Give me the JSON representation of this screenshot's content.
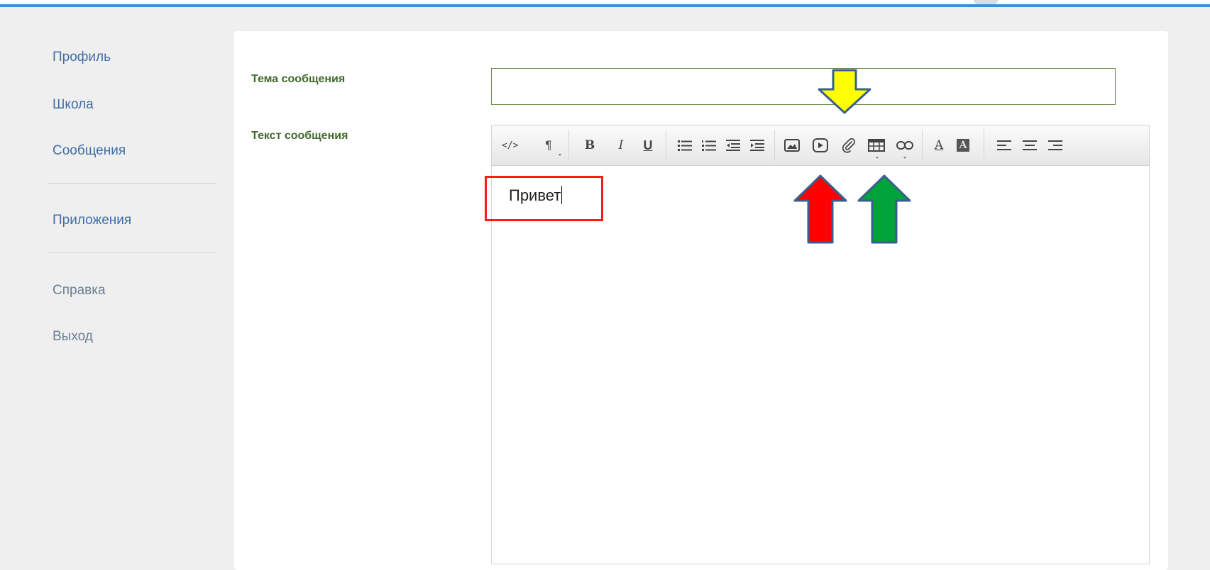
{
  "sidebar": {
    "items": [
      {
        "label": "Профиль"
      },
      {
        "label": "Школа"
      },
      {
        "label": "Сообщения"
      },
      {
        "label": "Приложения"
      },
      {
        "label": "Справка"
      },
      {
        "label": "Выход"
      }
    ]
  },
  "form": {
    "subject_label": "Тема сообщения",
    "subject_value": "",
    "body_label": "Текст сообщения",
    "body_text": "Привет"
  },
  "toolbar": {
    "buttons": [
      "html-source",
      "paragraph",
      "bold",
      "italic",
      "underline",
      "unordered-list",
      "ordered-list",
      "outdent",
      "indent",
      "image",
      "video",
      "file",
      "table",
      "link",
      "font-color",
      "background-color",
      "align-left",
      "align-center",
      "align-right"
    ],
    "glyphs": {
      "html": "</>",
      "paragraph": "¶",
      "bold": "B",
      "italic": "I",
      "underline": "U",
      "font_color": "A",
      "background_color": "A"
    }
  },
  "annotations": {
    "colors": {
      "highlight_box": "#ff1a1a",
      "arrow_yellow": "#ffff00",
      "arrow_red": "#ff0000",
      "arrow_green": "#00a33a",
      "arrow_outline": "#3a5f8f"
    }
  },
  "colors": {
    "accent_bar": "#3b8fd8",
    "nav_link": "#3f6fa6",
    "label_green": "#3f6a2a"
  }
}
